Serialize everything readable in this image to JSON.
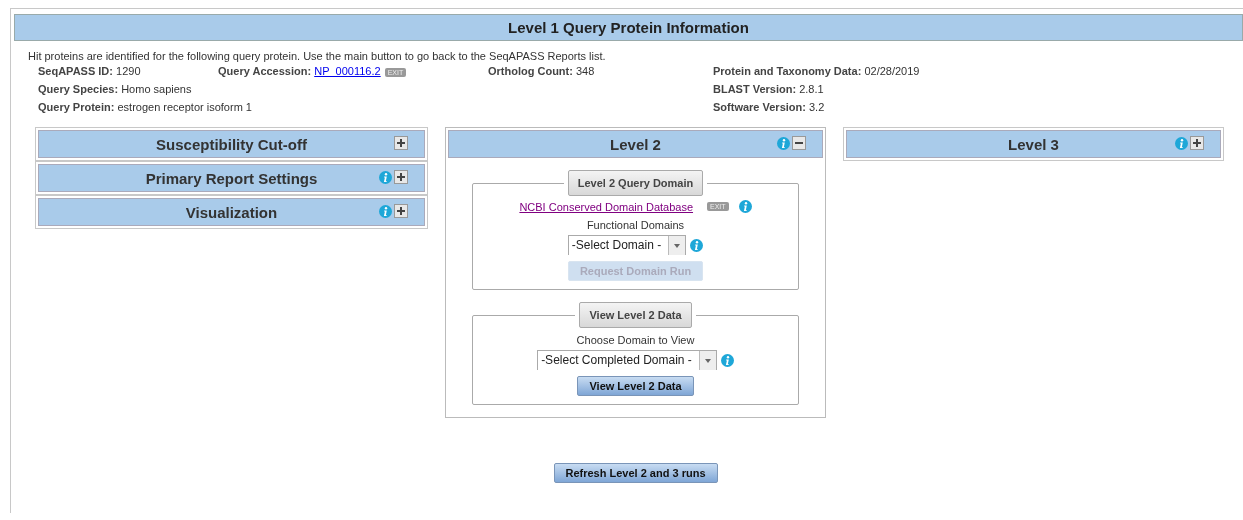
{
  "header": {
    "title": "Level 1 Query Protein Information"
  },
  "intro": "Hit proteins are identified for the following query protein. Use the main button to go back to the SeqAPASS Reports list.",
  "info_columns": [
    [
      {
        "label": "SeqAPASS ID:",
        "value": "1290",
        "kind": "text"
      },
      {
        "label": "Query Species:",
        "value": "Homo sapiens",
        "kind": "text"
      },
      {
        "label": "Query Protein:",
        "value": "estrogen receptor isoform 1",
        "kind": "text"
      }
    ],
    [
      {
        "label": "Query Accession:",
        "value": "NP_000116.2",
        "kind": "link",
        "badge": "EXIT"
      }
    ],
    [
      {
        "label": "Ortholog Count:",
        "value": "348",
        "kind": "text"
      }
    ],
    [
      {
        "label": "Protein and Taxonomy Data:",
        "value": "02/28/2019",
        "kind": "text"
      },
      {
        "label": "BLAST Version:",
        "value": "2.8.1",
        "kind": "text"
      },
      {
        "label": "Software Version:",
        "value": "3.2",
        "kind": "text"
      }
    ]
  ],
  "left_panels": [
    {
      "title": "Susceptibility Cut-off",
      "info": false,
      "expanded": false
    },
    {
      "title": "Primary Report Settings",
      "info": true,
      "expanded": false
    },
    {
      "title": "Visualization",
      "info": true,
      "expanded": false
    }
  ],
  "level2": {
    "title": "Level 2",
    "info": true,
    "expanded": true,
    "sections": [
      {
        "legend": "Level 2 Query Domain",
        "link": "NCBI Conserved Domain Database",
        "badge": "EXIT",
        "label": "Functional Domains",
        "select": "-Select Domain -",
        "button": {
          "label": "Request Domain Run",
          "disabled": true
        }
      },
      {
        "legend": "View Level 2 Data",
        "label": "Choose Domain to View",
        "select": "-Select Completed Domain -",
        "button": {
          "label": "View Level 2 Data",
          "disabled": false
        }
      }
    ]
  },
  "level3": {
    "title": "Level 3",
    "info": true,
    "expanded": false
  },
  "refresh_button": "Refresh Level 2 and 3 runs"
}
